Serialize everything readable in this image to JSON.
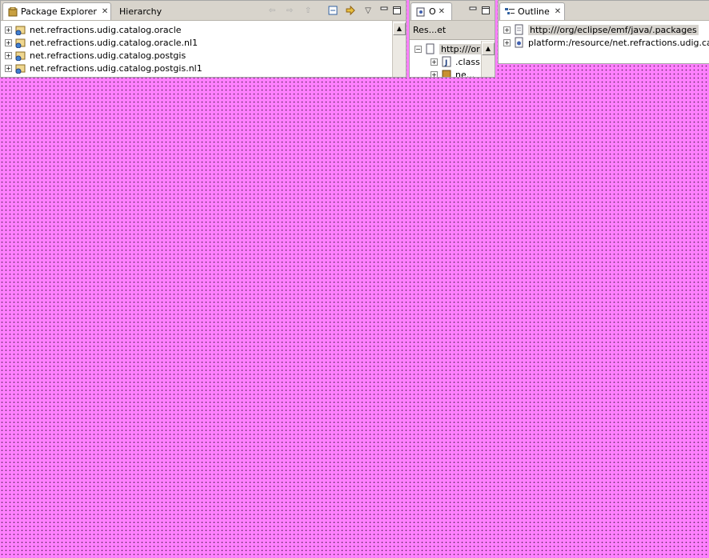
{
  "package_explorer": {
    "tabs": [
      {
        "label": "Package Explorer",
        "close": "✕"
      },
      {
        "label": "Hierarchy"
      }
    ],
    "items": [
      {
        "label": "net.refractions.udig.catalog.oracle"
      },
      {
        "label": "net.refractions.udig.catalog.oracle.nl1"
      },
      {
        "label": "net.refractions.udig.catalog.postgis"
      },
      {
        "label": "net.refractions.udig.catalog.postgis.nl1"
      }
    ]
  },
  "middle_view": {
    "tab": {
      "label": "O",
      "close": "✕"
    },
    "header": "Res...et",
    "items": [
      {
        "label": "http:///or"
      },
      {
        "label": ".class"
      },
      {
        "label": "ne..."
      }
    ]
  },
  "outline": {
    "tab": {
      "label": "Outline",
      "close": "✕"
    },
    "items": [
      {
        "label": "http:///org/eclipse/emf/java/.packages"
      },
      {
        "label": "platform:/resource/net.refractions.udig.catalog"
      }
    ]
  },
  "colors": {
    "corrupt_fill": "#ff80ff",
    "tab_bar": "#d8d4cc",
    "selection": "#d6d3ce"
  }
}
